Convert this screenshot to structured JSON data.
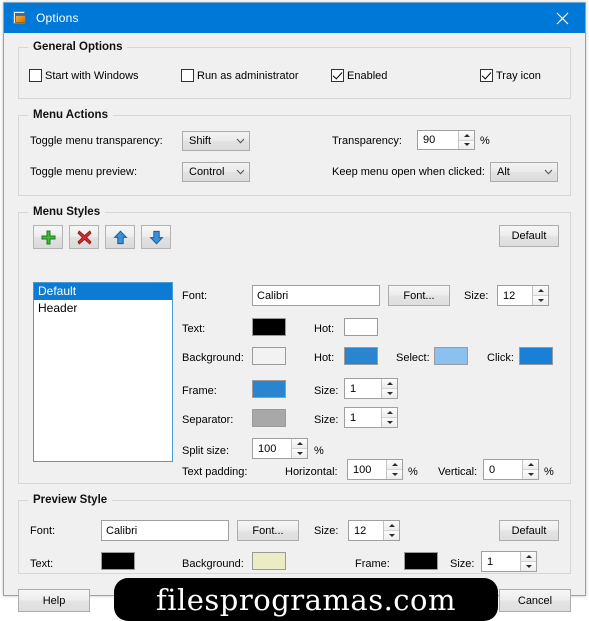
{
  "window": {
    "title": "Options",
    "icon": "options-document-icon",
    "close_label": "✕",
    "accent_color": "#0078d7"
  },
  "general_options": {
    "title": "General Options",
    "checkboxes": [
      {
        "label": "Start with Windows",
        "checked": false
      },
      {
        "label": "Run as administrator",
        "checked": false
      },
      {
        "label": "Enabled",
        "checked": true
      },
      {
        "label": "Tray icon",
        "checked": true
      }
    ]
  },
  "menu_actions": {
    "title": "Menu Actions",
    "toggle_transparency_label": "Toggle menu transparency:",
    "toggle_transparency_value": "Shift",
    "toggle_preview_label": "Toggle menu preview:",
    "toggle_preview_value": "Control",
    "transparency_label": "Transparency:",
    "transparency_value": "90",
    "transparency_unit": "%",
    "keep_open_label": "Keep menu open when clicked:",
    "keep_open_value": "Alt"
  },
  "menu_styles": {
    "title": "Menu Styles",
    "toolbar": {
      "add": "add-style",
      "delete": "delete-style",
      "move_up": "move-style-up",
      "move_down": "move-style-down"
    },
    "default_button": "Default",
    "list_items": [
      {
        "label": "Default",
        "selected": true
      },
      {
        "label": "Header",
        "selected": false
      }
    ],
    "font_label": "Font:",
    "font_value": "Calibri",
    "font_button": "Font...",
    "font_size_label": "Size:",
    "font_size_value": "12",
    "text_label": "Text:",
    "text_color": "#000000",
    "text_hot_label": "Hot:",
    "text_hot_color": "#ffffff",
    "background_label": "Background:",
    "background_color": "#f2f2f2",
    "background_hot_label": "Hot:",
    "background_hot_color": "#2a85d0",
    "background_select_label": "Select:",
    "background_select_color": "#8cc0ef",
    "background_click_label": "Click:",
    "background_click_color": "#1880d6",
    "frame_label": "Frame:",
    "frame_color": "#2a85d0",
    "frame_size_label": "Size:",
    "frame_size_value": "1",
    "separator_label": "Separator:",
    "separator_color": "#a8a8a8",
    "separator_size_label": "Size:",
    "separator_size_value": "1",
    "split_size_label": "Split size:",
    "split_size_value": "100",
    "split_size_unit": "%",
    "text_padding_label": "Text padding:",
    "padding_horizontal_label": "Horizontal:",
    "padding_horizontal_value": "100",
    "padding_horizontal_unit": "%",
    "padding_vertical_label": "Vertical:",
    "padding_vertical_value": "0",
    "padding_vertical_unit": "%"
  },
  "preview_style": {
    "title": "Preview Style",
    "font_label": "Font:",
    "font_value": "Calibri",
    "font_button": "Font...",
    "font_size_label": "Size:",
    "font_size_value": "12",
    "default_button": "Default",
    "text_label": "Text:",
    "text_color": "#000000",
    "background_label": "Background:",
    "background_color": "#ebebc4",
    "frame_label": "Frame:",
    "frame_color": "#000000",
    "frame_size_label": "Size:",
    "frame_size_value": "1"
  },
  "footer": {
    "help_label": "Help",
    "cancel_label": "Cancel"
  },
  "watermark": {
    "text": "filesprogramas.com"
  }
}
